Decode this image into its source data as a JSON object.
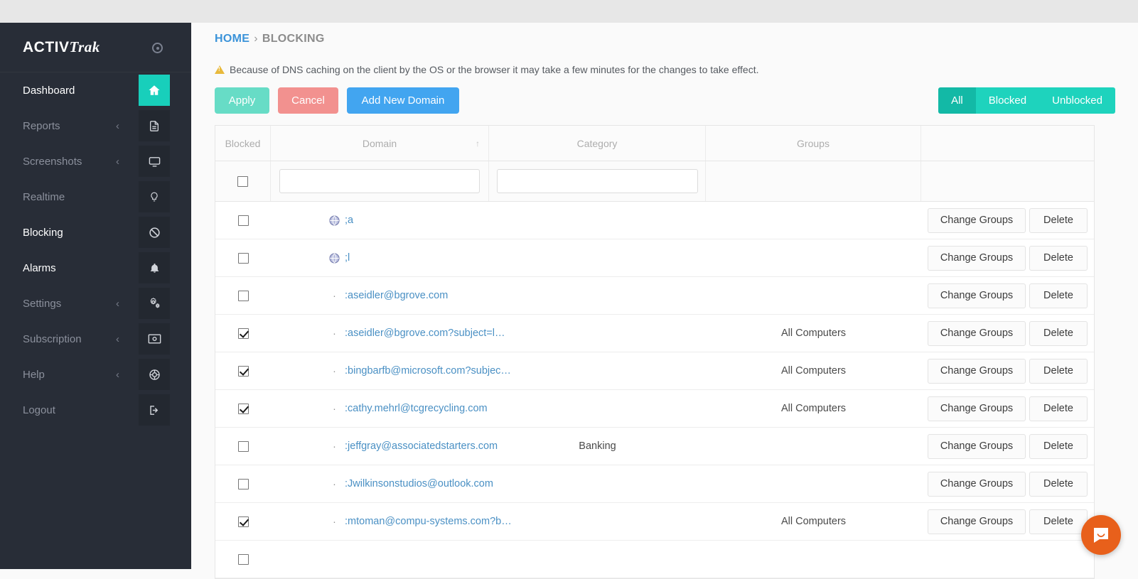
{
  "sidebar": {
    "logo_activ": "ACTIV",
    "logo_trak": "Trak",
    "items": [
      {
        "label": "Dashboard",
        "icon": "home-icon",
        "caret": "",
        "active": true
      },
      {
        "label": "Reports",
        "icon": "document-icon",
        "caret": "‹",
        "active": false
      },
      {
        "label": "Screenshots",
        "icon": "monitor-icon",
        "caret": "‹",
        "active": false
      },
      {
        "label": "Realtime",
        "icon": "lightbulb-icon",
        "caret": "",
        "active": false
      },
      {
        "label": "Blocking",
        "icon": "block-icon",
        "caret": "",
        "active": false
      },
      {
        "label": "Alarms",
        "icon": "bell-icon",
        "caret": "",
        "active": false
      },
      {
        "label": "Settings",
        "icon": "gears-icon",
        "caret": "‹",
        "active": false
      },
      {
        "label": "Subscription",
        "icon": "money-icon",
        "caret": "‹",
        "active": false
      },
      {
        "label": "Help",
        "icon": "lifebuoy-icon",
        "caret": "‹",
        "active": false
      },
      {
        "label": "Logout",
        "icon": "sign-out-icon",
        "caret": "",
        "active": false
      }
    ]
  },
  "breadcrumb": {
    "home": "HOME",
    "separator": "›",
    "current": "BLOCKING"
  },
  "notice": {
    "text": "Because of DNS caching on the client by the OS or the browser it may take a few minutes for the changes to take effect.",
    "icon": "warning-icon"
  },
  "toolbar": {
    "apply_label": "Apply",
    "cancel_label": "Cancel",
    "add_label": "Add New Domain"
  },
  "filters": {
    "all_label": "All",
    "blocked_label": "Blocked",
    "unblocked_label": "Unblocked",
    "selected": "All"
  },
  "table": {
    "columns": [
      "Blocked",
      "Domain",
      "Category",
      "Groups",
      ""
    ],
    "sort_column": "Domain",
    "sort_indicator": "↑",
    "filter_row": {
      "domain_value": "",
      "domain_placeholder": "",
      "category_value": "",
      "category_placeholder": "",
      "select_all_checked": false
    },
    "rows": [
      {
        "blocked": false,
        "icon": "globe-favicon",
        "domain": ";a",
        "category": "",
        "groups": ""
      },
      {
        "blocked": false,
        "icon": "globe-favicon",
        "domain": ";l",
        "category": "",
        "groups": ""
      },
      {
        "blocked": false,
        "icon": "dash-mark",
        "domain": ":aseidler@bgrove.com",
        "category": "",
        "groups": ""
      },
      {
        "blocked": true,
        "icon": "dash-mark",
        "domain": ":aseidler@bgrove.com?subject=l…",
        "category": "",
        "groups": "All Computers"
      },
      {
        "blocked": true,
        "icon": "dash-mark",
        "domain": ":bingbarfb@microsoft.com?subjec…",
        "category": "",
        "groups": "All Computers"
      },
      {
        "blocked": true,
        "icon": "dash-mark",
        "domain": ":cathy.mehrl@tcgrecycling.com",
        "category": "",
        "groups": "All Computers"
      },
      {
        "blocked": false,
        "icon": "dash-mark",
        "domain": ":jeffgray@associatedstarters.com",
        "category": "Banking",
        "groups": ""
      },
      {
        "blocked": false,
        "icon": "dash-mark",
        "domain": ":Jwilkinsonstudios@outlook.com",
        "category": "",
        "groups": ""
      },
      {
        "blocked": true,
        "icon": "dash-mark",
        "domain": ":mtoman@compu-systems.com?b…",
        "category": "",
        "groups": "All Computers"
      },
      {
        "blocked": false,
        "icon": "dash-mark",
        "domain": "",
        "category": "",
        "groups": ""
      }
    ],
    "row_actions": {
      "change_groups_label": "Change Groups",
      "delete_label": "Delete"
    }
  },
  "chat": {
    "icon": "intercom-chat-icon",
    "color": "#e8601b"
  },
  "colors": {
    "sidebar_bg": "#282d37",
    "accent_teal": "#1ed3bd",
    "accent_teal_active": "#13b9a6",
    "apply_green": "#67dcc6",
    "cancel_red": "#f2918f",
    "add_blue": "#42a5f0",
    "link_blue": "#4a90c4",
    "crumb_blue": "#3b93d9"
  }
}
